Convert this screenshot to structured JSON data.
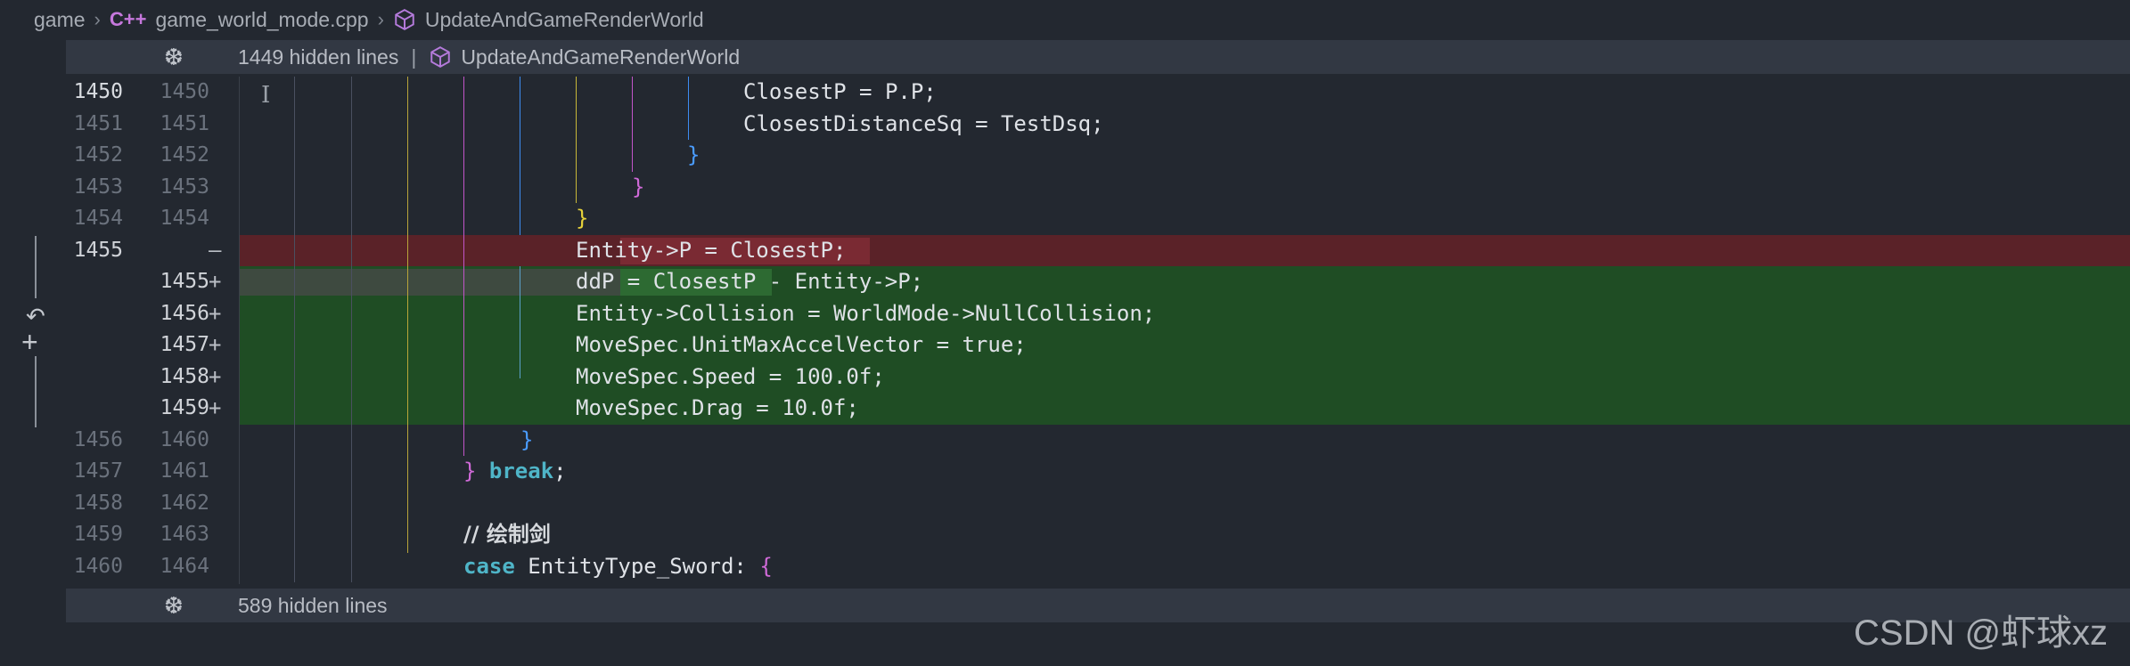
{
  "breadcrumb": {
    "root": "game",
    "file": "game_world_mode.cpp",
    "function": "UpdateAndGameRenderWorld",
    "file_icon": "cpp-icon",
    "function_icon": "cube-icon"
  },
  "fold_top": {
    "text": "1449 hidden lines",
    "separator": "|",
    "function": "UpdateAndGameRenderWorld"
  },
  "fold_bottom": {
    "text": "589 hidden lines"
  },
  "rows": [
    {
      "old": "1450",
      "new": "1450",
      "mark": "",
      "kind": "ctx",
      "cur": true
    },
    {
      "old": "1451",
      "new": "1451",
      "mark": "",
      "kind": "ctx"
    },
    {
      "old": "1452",
      "new": "1452",
      "mark": "",
      "kind": "ctx"
    },
    {
      "old": "1453",
      "new": "1453",
      "mark": "",
      "kind": "ctx"
    },
    {
      "old": "1454",
      "new": "1454",
      "mark": "",
      "kind": "ctx"
    },
    {
      "old": "1455",
      "new": "",
      "mark": "—",
      "kind": "del"
    },
    {
      "old": "",
      "new": "1455",
      "mark": "+",
      "kind": "add"
    },
    {
      "old": "",
      "new": "1456",
      "mark": "+",
      "kind": "add"
    },
    {
      "old": "",
      "new": "1457",
      "mark": "+",
      "kind": "add"
    },
    {
      "old": "",
      "new": "1458",
      "mark": "+",
      "kind": "add"
    },
    {
      "old": "",
      "new": "1459",
      "mark": "+",
      "kind": "add"
    },
    {
      "old": "1456",
      "new": "1460",
      "mark": "",
      "kind": "ctx"
    },
    {
      "old": "1457",
      "new": "1461",
      "mark": "",
      "kind": "ctx"
    },
    {
      "old": "1458",
      "new": "1462",
      "mark": "",
      "kind": "ctx"
    },
    {
      "old": "1459",
      "new": "1463",
      "mark": "",
      "kind": "ctx"
    },
    {
      "old": "1460",
      "new": "1464",
      "mark": "",
      "kind": "ctx"
    }
  ],
  "code": {
    "l0": "ClosestP = P.P;",
    "l1": "ClosestDistanceSq = TestDsq;",
    "l2": "}",
    "l3": "}",
    "l4": "}",
    "l5": "Entity->P = ClosestP;",
    "l6": "ddP = ClosestP - Entity->P;",
    "l7": "Entity->Collision = WorldMode->NullCollision;",
    "l8": "MoveSpec.UnitMaxAccelVector = true;",
    "l9": "MoveSpec.Speed = 100.0f;",
    "l10": "MoveSpec.Drag = 10.0f;",
    "l11": "}",
    "l12a": "}",
    "l12b": "break",
    "l12c": ";",
    "l14": "// 绘制剑",
    "l15a": "case",
    "l15b": " EntityType_Sword: ",
    "l15c": "{"
  },
  "watermark": "CSDN @虾球xz"
}
